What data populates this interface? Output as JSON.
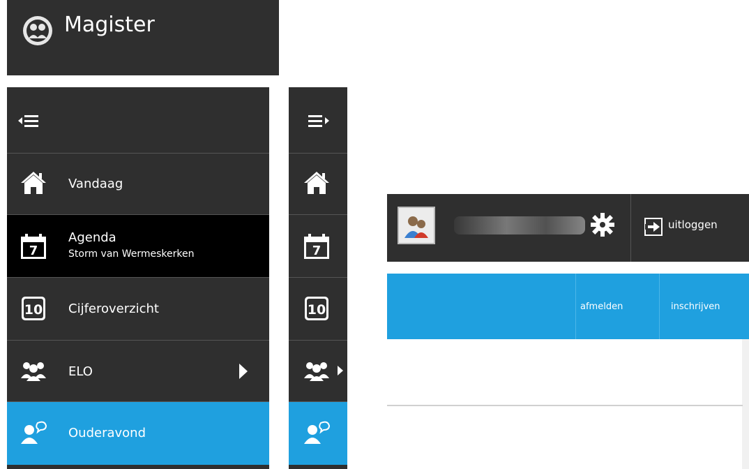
{
  "app": {
    "title": "Magister"
  },
  "sidebar": {
    "items": [
      {
        "label": "Vandaag",
        "icon": "home-icon"
      },
      {
        "label": "Agenda",
        "sublabel": "Storm van Wermeskerken",
        "icon": "calendar-icon",
        "calendar_day": "7"
      },
      {
        "label": "Cijferoverzicht",
        "icon": "grade-icon",
        "grade_number": "10"
      },
      {
        "label": "ELO",
        "icon": "users-icon"
      },
      {
        "label": "Ouderavond",
        "icon": "parent-meeting-icon"
      }
    ]
  },
  "topbar": {
    "logout_label": "uitloggen"
  },
  "subbar": {
    "actions": [
      "afmelden",
      "inschrijven"
    ]
  },
  "colors": {
    "dark": "#2f2f2f",
    "black": "#000000",
    "accent": "#1fa0df",
    "text": "#ffffff"
  }
}
